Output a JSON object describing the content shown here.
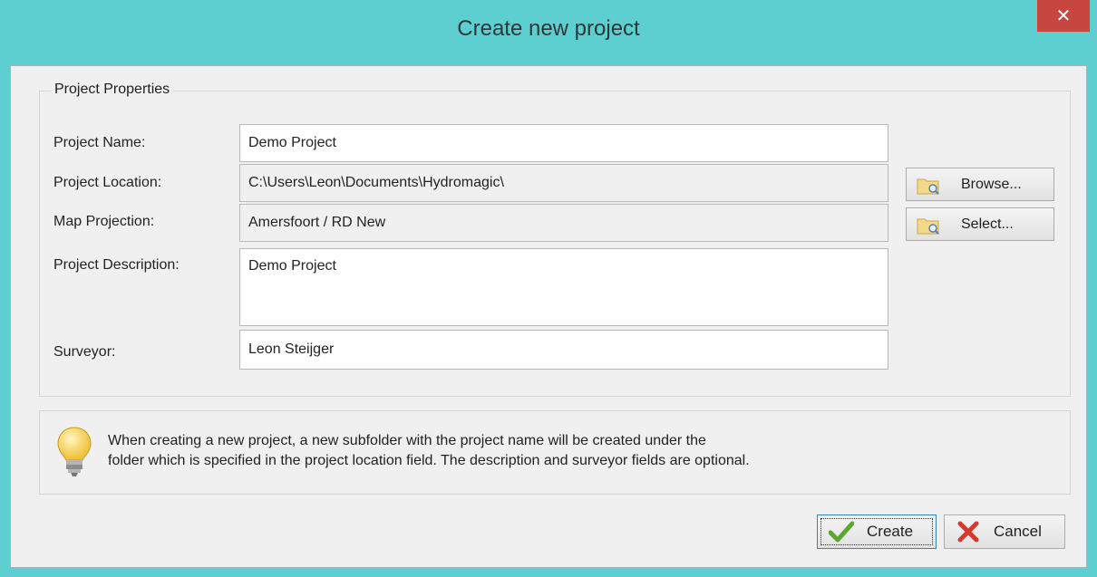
{
  "window": {
    "title": "Create new project",
    "close_label": "✕"
  },
  "group": {
    "title": "Project Properties"
  },
  "fields": {
    "name": {
      "label": "Project Name:",
      "value": "Demo Project"
    },
    "location": {
      "label": "Project Location:",
      "value": "C:\\Users\\Leon\\Documents\\Hydromagic\\"
    },
    "projection": {
      "label": "Map Projection:",
      "value": "Amersfoort / RD New"
    },
    "description": {
      "label": "Project Description:",
      "value": "Demo Project"
    },
    "surveyor": {
      "label": "Surveyor:",
      "value": "Leon Steijger"
    }
  },
  "side_buttons": {
    "browse": "Browse...",
    "select": "Select..."
  },
  "info": {
    "line1": "When creating a new project, a new subfolder with the project name will be created under the",
    "line2": "folder which is specified in the project location field. The description and surveyor fields are optional."
  },
  "buttons": {
    "create": "Create",
    "cancel": "Cancel"
  },
  "colors": {
    "frame": "#5ecfd0",
    "close": "#c7463f",
    "dialog_bg": "#f0f0f0"
  }
}
